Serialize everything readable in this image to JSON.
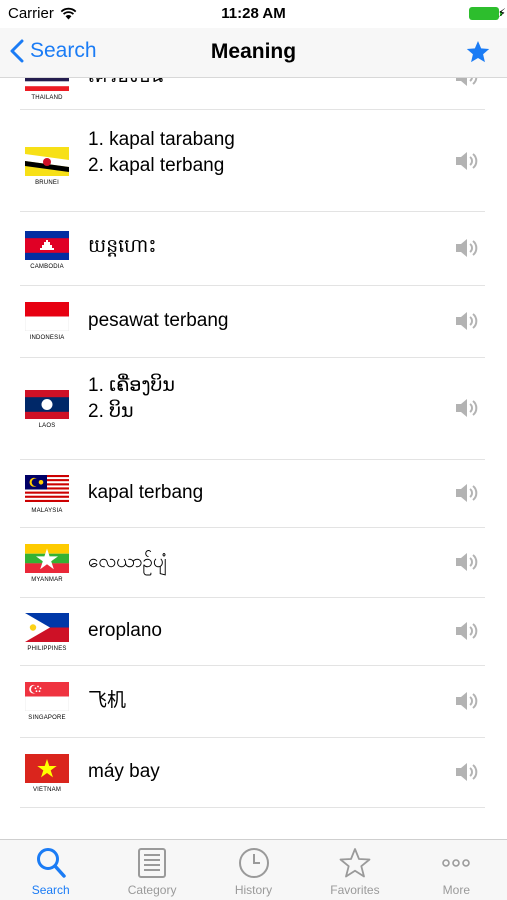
{
  "status_bar": {
    "carrier": "Carrier",
    "time": "11:28 AM"
  },
  "nav": {
    "back_label": "Search",
    "title": "Meaning"
  },
  "rows": [
    {
      "country": "THAILAND",
      "lines": [
        "เครื่องบิน"
      ]
    },
    {
      "country": "BRUNEI",
      "lines": [
        "1. kapal tarabang",
        "2. kapal terbang"
      ]
    },
    {
      "country": "CAMBODIA",
      "lines": [
        "យន្តហោះ"
      ]
    },
    {
      "country": "INDONESIA",
      "lines": [
        "pesawat terbang"
      ]
    },
    {
      "country": "LAOS",
      "lines": [
        "1. ເຄື່ອງບິນ",
        "2. ບິນ"
      ]
    },
    {
      "country": "MALAYSIA",
      "lines": [
        "kapal terbang"
      ]
    },
    {
      "country": "MYANMAR",
      "lines": [
        "လေယာဉ်ပျံ"
      ]
    },
    {
      "country": "PHILIPPINES",
      "lines": [
        "eroplano"
      ]
    },
    {
      "country": "SINGAPORE",
      "lines": [
        "飞机"
      ]
    },
    {
      "country": "VIETNAM",
      "lines": [
        "máy bay"
      ]
    }
  ],
  "tabs": [
    {
      "label": "Search",
      "icon": "search-icon",
      "active": true
    },
    {
      "label": "Category",
      "icon": "category-icon",
      "active": false
    },
    {
      "label": "History",
      "icon": "clock-icon",
      "active": false
    },
    {
      "label": "Favorites",
      "icon": "star-icon",
      "active": false
    },
    {
      "label": "More",
      "icon": "more-icon",
      "active": false
    }
  ],
  "colors": {
    "accent": "#1b7cf5",
    "inactive": "#9a9a9a",
    "battery": "#2dbe2d"
  }
}
